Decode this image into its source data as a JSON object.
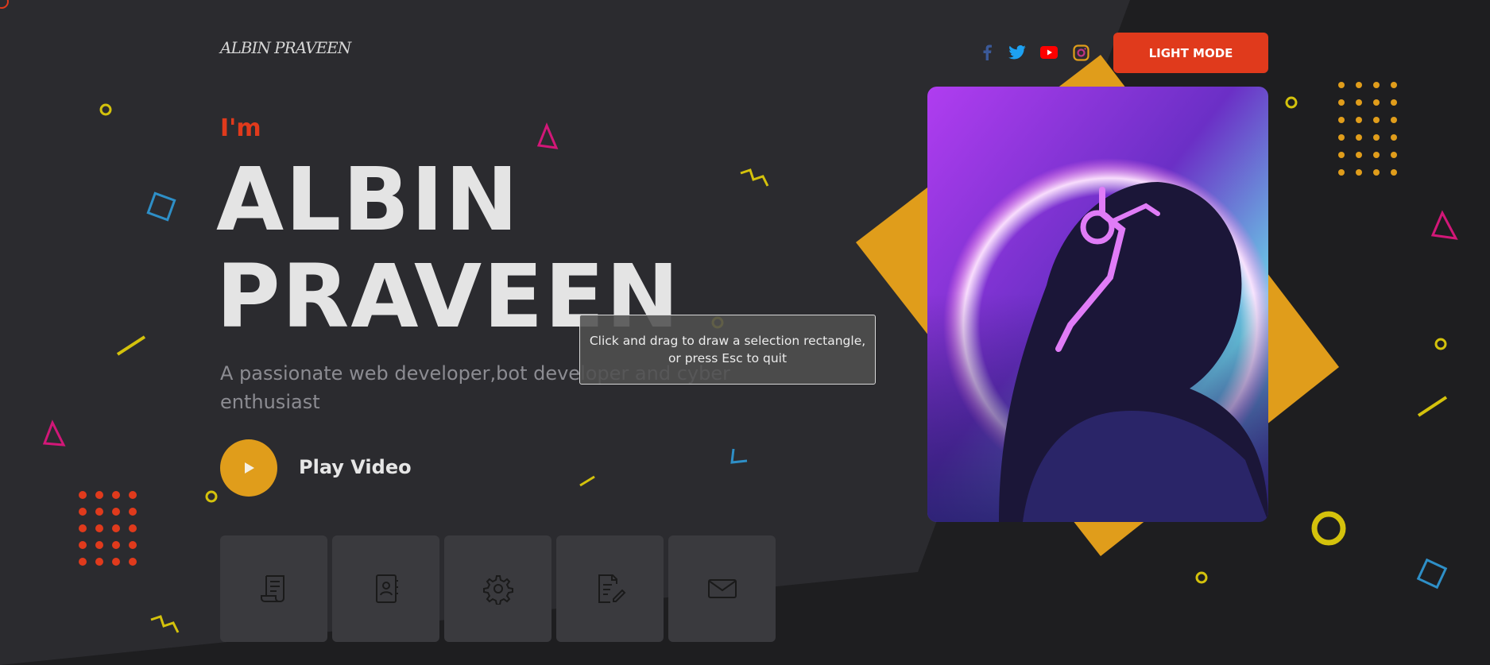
{
  "header": {
    "logo_text": "ALBIN PRAVEEN",
    "social": [
      {
        "icon": "facebook-icon",
        "color": "#3b5998"
      },
      {
        "icon": "twitter-icon",
        "color": "#1da1f2"
      },
      {
        "icon": "youtube-icon",
        "color": "#ff0000"
      },
      {
        "icon": "instagram-icon",
        "color": "#c13584"
      }
    ],
    "mode_button_label": "LIGHT MODE"
  },
  "hero": {
    "intro": "I'm",
    "name_line1": "ALBIN",
    "name_line2": "PRAVEEN",
    "tagline_line1": "A passionate web developer,bot developer and cyber",
    "tagline_line2": "enthusiast",
    "play_label": "Play Video"
  },
  "tiles": [
    {
      "icon": "resume-scroll-icon"
    },
    {
      "icon": "contact-book-icon"
    },
    {
      "icon": "gear-icon"
    },
    {
      "icon": "document-edit-icon"
    },
    {
      "icon": "mail-icon"
    }
  ],
  "overlay": {
    "line1": "Click and drag to draw a selection rectangle,",
    "line2": "or press Esc to quit"
  },
  "colors": {
    "accent_red": "#e03a1c",
    "accent_orange": "#e09d1b",
    "panel_dark": "#2b2b2f",
    "background": "#1e1e20"
  }
}
